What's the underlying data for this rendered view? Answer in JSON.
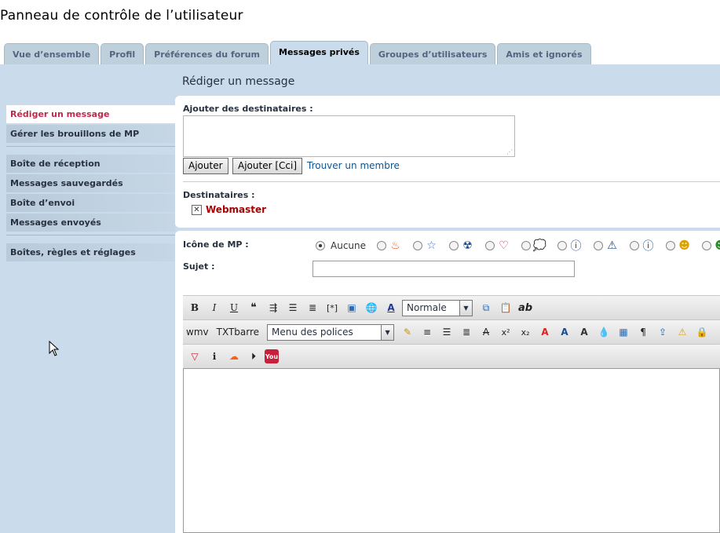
{
  "page_title": "Panneau de contrôle de l’utilisateur",
  "tabs": [
    {
      "label": "Vue d’ensemble"
    },
    {
      "label": "Profil"
    },
    {
      "label": "Préférences du forum"
    },
    {
      "label": "Messages privés",
      "active": true
    },
    {
      "label": "Groupes d’utilisateurs"
    },
    {
      "label": "Amis et ignorés"
    }
  ],
  "sidebar": {
    "items": [
      {
        "label": "Rédiger un message"
      },
      {
        "label": "Gérer les brouillons de MP"
      },
      {
        "label": "Boîte de réception"
      },
      {
        "label": "Messages sauvegardés"
      },
      {
        "label": "Boîte d’envoi"
      },
      {
        "label": "Messages envoyés"
      },
      {
        "label": "Boîtes, règles et réglages"
      }
    ]
  },
  "main": {
    "heading": "Rédiger un message",
    "add_recipients_label": "Ajouter des destinataires :",
    "add_button": "Ajouter",
    "add_bcc_button": "Ajouter [Cci]",
    "find_member_link": "Trouver un membre",
    "recipients_label": "Destinataires :",
    "recipient": "Webmaster",
    "pm_icon_label": "Icône de MP :",
    "pm_icon_none": "Aucune",
    "subject_label": "Sujet :",
    "subject_value": ""
  },
  "editor": {
    "font_size_select": "Normale",
    "wmv_label": "wmv",
    "txtbarre_label": "TXTbarre",
    "font_menu_select": "Menu des polices"
  },
  "colors": {
    "panel_bg": "#cadceb",
    "active_nav_text": "#bc2a4d",
    "recipient_color": "#aa0000",
    "link_color": "#105289"
  }
}
